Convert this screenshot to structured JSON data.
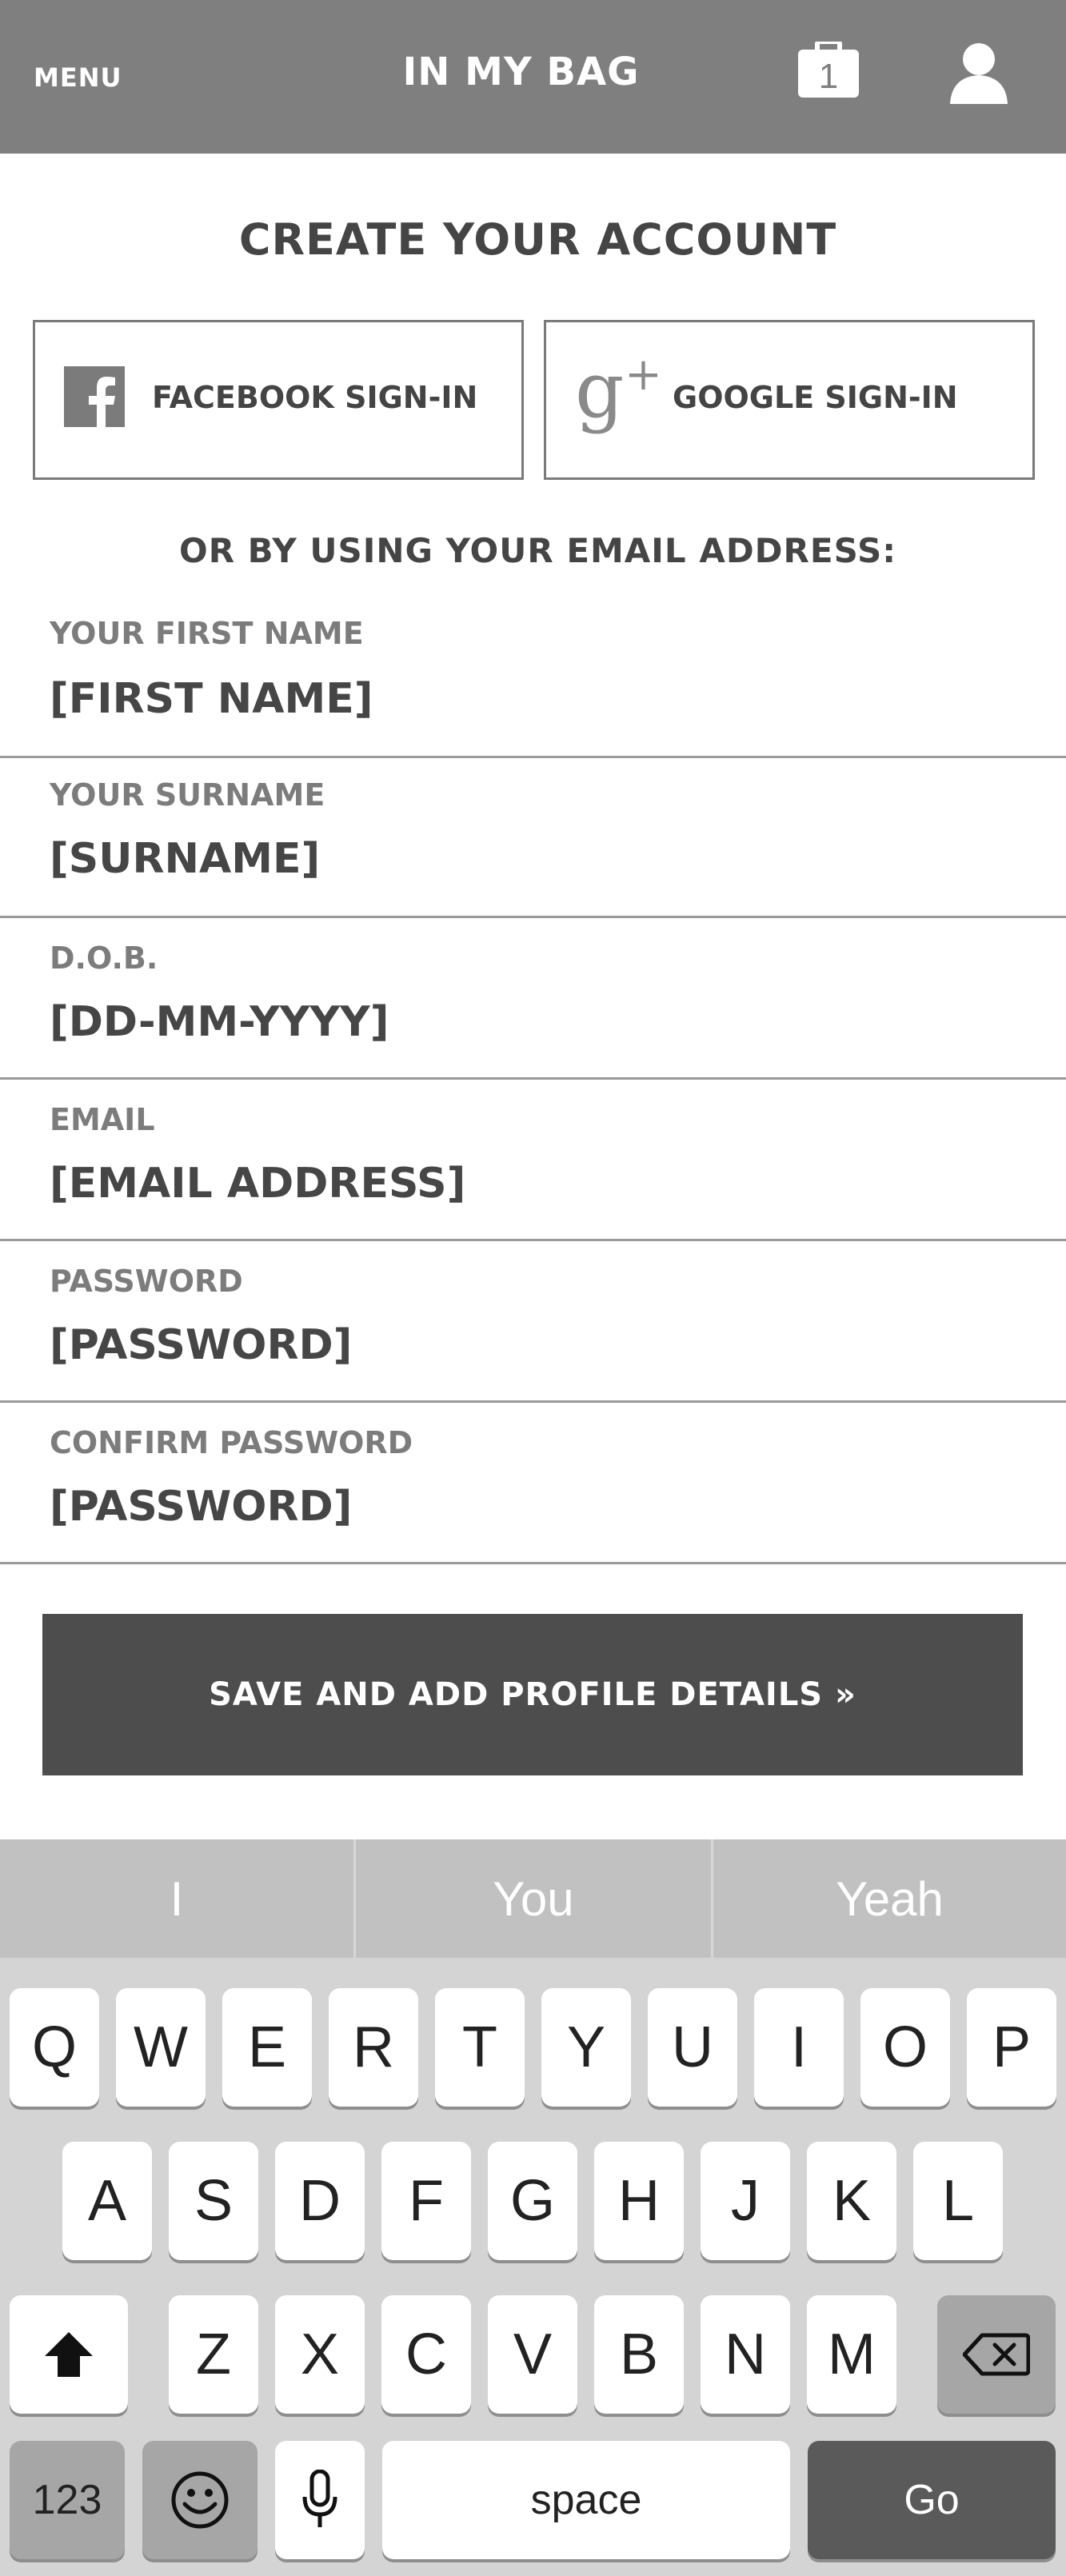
{
  "header": {
    "menu_label": "MENU",
    "title": "IN MY BAG",
    "bag_count": "1",
    "bag_icon": "shopping-bag-icon",
    "user_icon": "user-icon"
  },
  "page_title": "CREATE YOUR ACCOUNT",
  "social": {
    "facebook_label": "FACEBOOK SIGN-IN",
    "google_label": "GOOGLE SIGN-IN"
  },
  "or_email_text": "OR BY USING YOUR EMAIL ADDRESS:",
  "fields": [
    {
      "label": "YOUR FIRST NAME",
      "value": "[FIRST NAME]"
    },
    {
      "label": "YOUR SURNAME",
      "value": "[SURNAME]"
    },
    {
      "label": "D.O.B.",
      "value": "[DD-MM-YYYY]"
    },
    {
      "label": "EMAIL",
      "value": "[EMAIL ADDRESS]"
    },
    {
      "label": "PASSWORD",
      "value": "[PASSWORD]"
    },
    {
      "label": "CONFIRM PASSWORD",
      "value": "[PASSWORD]"
    }
  ],
  "save_button_label": "SAVE AND ADD PROFILE DETAILS »",
  "keyboard": {
    "suggestions": [
      "I",
      "You",
      "Yeah"
    ],
    "row1": [
      "Q",
      "W",
      "E",
      "R",
      "T",
      "Y",
      "U",
      "I",
      "O",
      "P"
    ],
    "row2": [
      "A",
      "S",
      "D",
      "F",
      "G",
      "H",
      "J",
      "K",
      "L"
    ],
    "row3": [
      "Z",
      "X",
      "C",
      "V",
      "B",
      "N",
      "M"
    ],
    "numbers_label": "123",
    "space_label": "space",
    "go_label": "Go"
  },
  "colors": {
    "header_bg": "#7f7f7f",
    "button_bg": "#4d4d4d",
    "keyboard_bg": "#d4d4d4"
  }
}
